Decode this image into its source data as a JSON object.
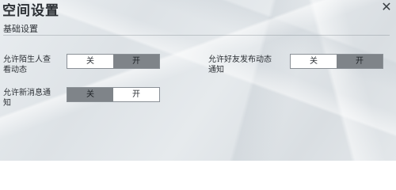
{
  "header": {
    "title": "空间设置",
    "close_glyph": "✕"
  },
  "section": {
    "title": "基础设置"
  },
  "settings": [
    {
      "label_line1": "允许陌生人查",
      "label_line2": "看动态",
      "off_label": "关",
      "on_label": "开",
      "selected": "关"
    },
    {
      "label_line1": "允许好友发布动态",
      "label_line2": "通知",
      "off_label": "关",
      "on_label": "开",
      "selected": "关"
    },
    {
      "label_line1": "允许新消息通",
      "label_line2": "知",
      "off_label": "关",
      "on_label": "开",
      "selected": "开"
    }
  ],
  "colors": {
    "selected": "#ffffff",
    "unselected": "#7f8489"
  },
  "icons": {
    "close": "close-icon"
  }
}
